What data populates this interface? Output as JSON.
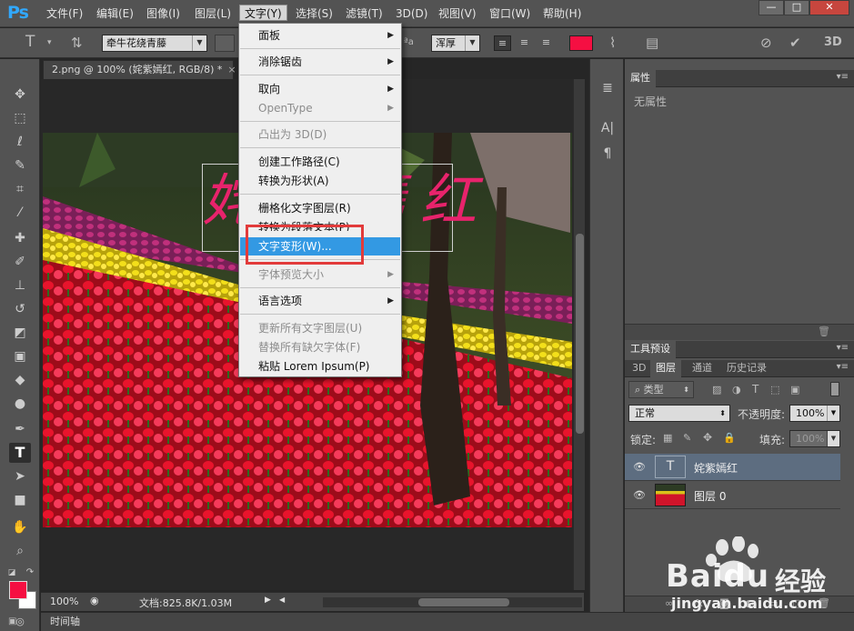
{
  "app": {
    "logo": "Ps"
  },
  "menubar": {
    "items": [
      "文件(F)",
      "编辑(E)",
      "图像(I)",
      "图层(L)",
      "文字(Y)",
      "选择(S)",
      "滤镜(T)",
      "3D(D)",
      "视图(V)",
      "窗口(W)",
      "帮助(H)"
    ],
    "active_index": 4
  },
  "window_controls": {
    "minimize": "—",
    "maximize": "□",
    "close": "✕"
  },
  "options_bar": {
    "font_family": "牵牛花绕青藤",
    "aa_label": "ªa",
    "antialias": "浑厚",
    "text_color": "#f50f42"
  },
  "document": {
    "tab_title": "2.png @ 100% (姹紫嫣红, RGB/8) *",
    "tab_close": "×",
    "overlay_text": "姹紫嫣红",
    "zoom": "100%",
    "doc_info": "文档:825.8K/1.03M"
  },
  "text_menu": {
    "items": [
      {
        "label": "面板",
        "submenu": true,
        "disabled": false
      },
      {
        "label": "消除锯齿",
        "submenu": true,
        "disabled": false
      },
      {
        "label": "取向",
        "submenu": true,
        "disabled": false
      },
      {
        "label": "OpenType",
        "submenu": true,
        "disabled": true
      },
      {
        "label": "凸出为 3D(D)",
        "submenu": false,
        "disabled": true
      },
      {
        "label": "创建工作路径(C)",
        "submenu": false,
        "disabled": false
      },
      {
        "label": "转换为形状(A)",
        "submenu": false,
        "disabled": false
      },
      {
        "label": "栅格化文字图层(R)",
        "submenu": false,
        "disabled": false
      },
      {
        "label": "转换为段落文本(P)",
        "submenu": false,
        "disabled": false
      },
      {
        "label": "文字变形(W)...",
        "submenu": false,
        "disabled": false,
        "highlighted": true
      },
      {
        "label": "字体预览大小",
        "submenu": true,
        "disabled": true
      },
      {
        "label": "语言选项",
        "submenu": true,
        "disabled": false
      },
      {
        "label": "更新所有文字图层(U)",
        "submenu": false,
        "disabled": true
      },
      {
        "label": "替换所有缺欠字体(F)",
        "submenu": false,
        "disabled": true
      },
      {
        "label": "粘贴 Lorem Ipsum(P)",
        "submenu": false,
        "disabled": false
      }
    ]
  },
  "properties_panel": {
    "title": "属性",
    "empty_text": "无属性"
  },
  "tool_presets_panel": {
    "title": "工具预设"
  },
  "layers_panel": {
    "tabs": [
      "3D",
      "图层",
      "通道",
      "历史记录"
    ],
    "active_tab": 1,
    "filter_kind": "类型",
    "blend_mode": "正常",
    "opacity_label": "不透明度:",
    "opacity_value": "100%",
    "lock_label": "锁定:",
    "fill_label": "填充:",
    "fill_value": "100%",
    "layers": [
      {
        "name": "姹紫嫣红",
        "type": "text",
        "thumb_label": "T",
        "selected": true
      },
      {
        "name": "图层 0",
        "type": "image",
        "selected": false
      }
    ]
  },
  "timeline": {
    "label": "时间轴"
  },
  "watermark": {
    "brand": "Baidu",
    "cn": "经验",
    "url": "jingyan.baidu.com"
  }
}
